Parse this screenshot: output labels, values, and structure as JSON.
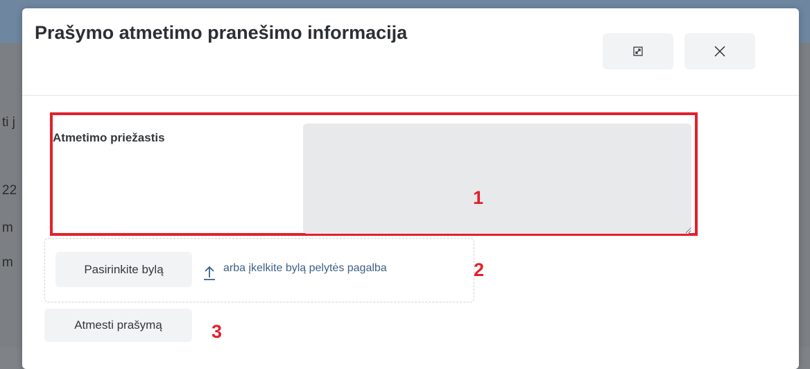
{
  "background": {
    "fragments": [
      "ti j",
      "22",
      "m",
      "m"
    ]
  },
  "dialog": {
    "title": "Prašymo atmetimo pranešimo informacija",
    "expand_icon": "expand-icon",
    "close_icon": "close-icon"
  },
  "form": {
    "reason_label": "Atmetimo priežastis",
    "reason_value": "",
    "choose_file_label": "Pasirinkite bylą",
    "upload_icon": "upload-icon",
    "drop_text": "arba įkelkite bylą pelytės pagalba",
    "reject_button_label": "Atmesti prašymą"
  },
  "annotations": {
    "n1": "1",
    "n2": "2",
    "n3": "3",
    "color": "#e3202b"
  }
}
